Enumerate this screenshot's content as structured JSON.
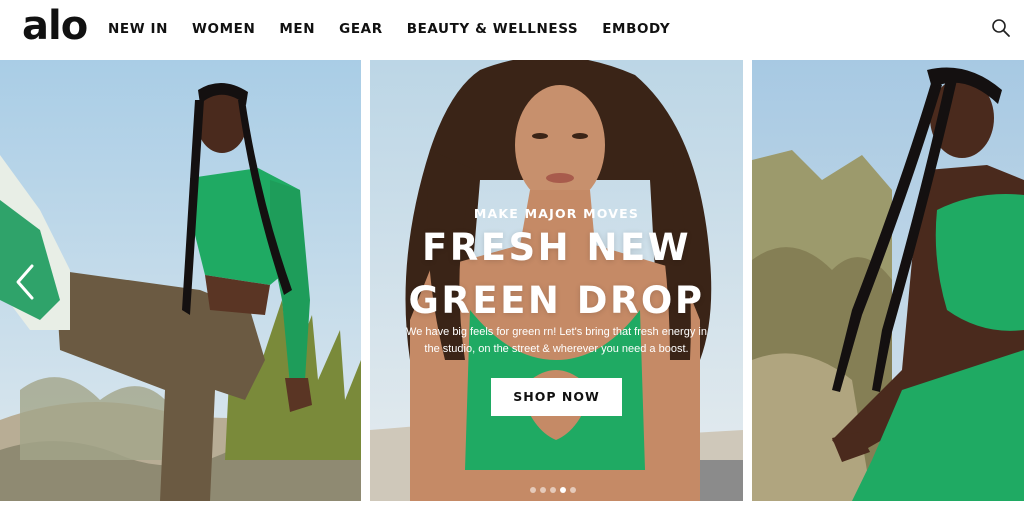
{
  "brand": {
    "logo_text": "alo"
  },
  "nav": {
    "items": [
      {
        "label": "NEW IN"
      },
      {
        "label": "WOMEN"
      },
      {
        "label": "MEN"
      },
      {
        "label": "GEAR"
      },
      {
        "label": "BEAUTY & WELLNESS"
      },
      {
        "label": "EMBODY"
      }
    ],
    "search_icon": "search-icon"
  },
  "hero": {
    "kicker": "MAKE MAJOR MOVES",
    "headline_line1": "FRESH NEW",
    "headline_line2": "GREEN DROP",
    "body": "We have big feels for green rn! Let's bring that fresh energy in the studio, on the street & wherever you need a boost.",
    "cta_label": "SHOP NOW",
    "carousel": {
      "slide_count": 5,
      "active_slide": 4
    },
    "prev_icon": "chevron-left-icon"
  },
  "colors": {
    "accent_green": "#1faa63",
    "sky": "#b9d5e8",
    "text_dark": "#111111"
  }
}
